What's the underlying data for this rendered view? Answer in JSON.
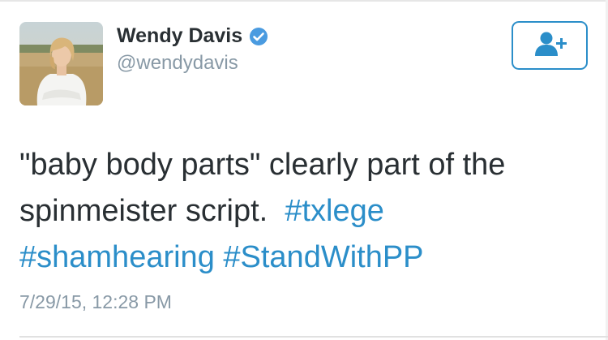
{
  "tweet": {
    "author": {
      "display_name": "Wendy Davis",
      "handle": "@wendydavis",
      "verified": true
    },
    "text_part1": "\"baby body parts\" clearly part of the spinmeister script.",
    "hashtags": [
      "#txlege",
      "#shamhearing",
      "#StandWithPP"
    ],
    "timestamp": "7/29/15, 12:28 PM"
  },
  "icons": {
    "verified": "verified-badge-icon",
    "follow": "add-user-icon"
  },
  "colors": {
    "link": "#2b8ec9",
    "name": "#292f33",
    "secondary": "#8899a6",
    "verified": "#4a9be0"
  }
}
